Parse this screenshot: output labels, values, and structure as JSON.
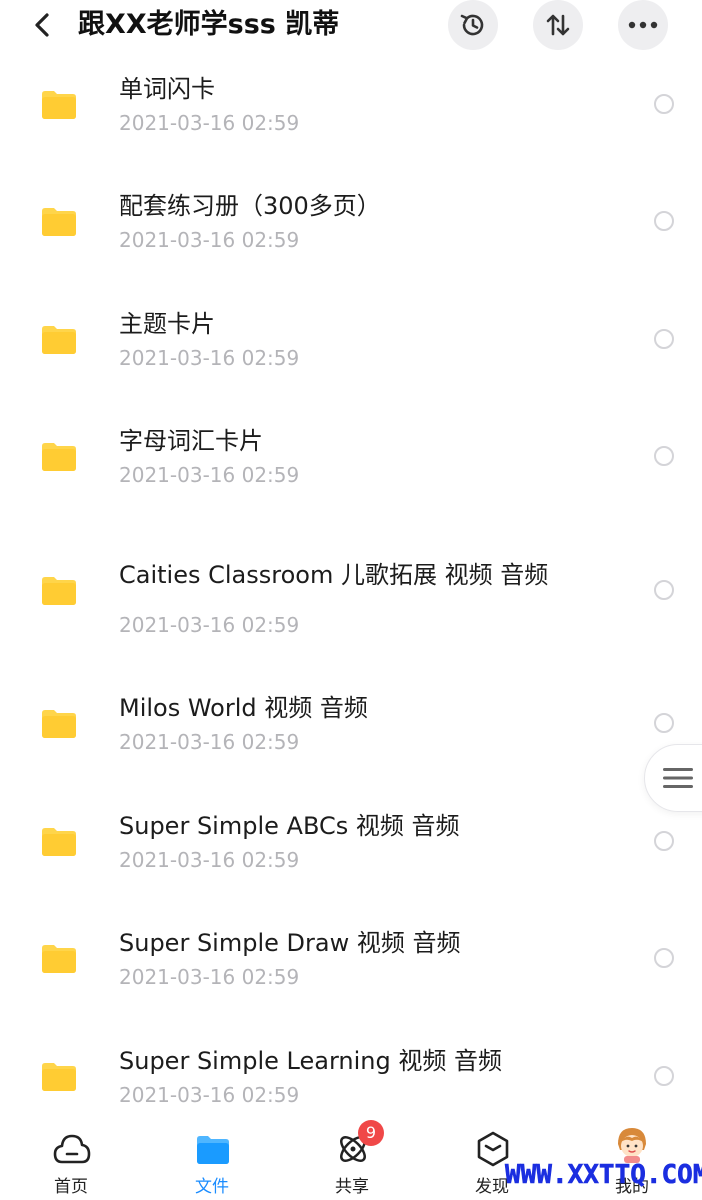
{
  "header": {
    "title": "跟XX老师学sss 凯蒂",
    "back_icon": "chevron-left-icon",
    "history_icon": "history-icon",
    "sort_icon": "sort-icon",
    "more_icon": "more-horizontal-icon"
  },
  "files": [
    {
      "name": "单词闪卡",
      "date": "2021-03-16 02:59"
    },
    {
      "name": "配套练习册（300多页）",
      "date": "2021-03-16 02:59"
    },
    {
      "name": "主题卡片",
      "date": "2021-03-16 02:59"
    },
    {
      "name": "字母词汇卡片",
      "date": "2021-03-16 02:59"
    },
    {
      "name": "Caities Classroom  儿歌拓展  视频  音频",
      "date": "2021-03-16 02:59"
    },
    {
      "name": "Milos World  视频  音频",
      "date": "2021-03-16 02:59"
    },
    {
      "name": "Super Simple ABCs 视频  音频",
      "date": "2021-03-16 02:59"
    },
    {
      "name": "Super Simple Draw 视频  音频",
      "date": "2021-03-16 02:59"
    },
    {
      "name": "Super Simple Learning 视频  音频",
      "date": "2021-03-16 02:59"
    }
  ],
  "tabbar": {
    "tabs": [
      {
        "label": "首页",
        "icon": "cloud-home-icon"
      },
      {
        "label": "文件",
        "icon": "folder-icon"
      },
      {
        "label": "共享",
        "icon": "share-atom-icon",
        "badge": "9"
      },
      {
        "label": "发现",
        "icon": "discover-cube-icon"
      },
      {
        "label": "我的",
        "icon": "avatar-icon"
      }
    ],
    "active_index": 1
  },
  "watermark": "WWW.XXTTQ.COM",
  "colors": {
    "folder": "#FFD54A",
    "accent": "#1A8CFF",
    "badge": "#F04848",
    "date_text": "#B4B4B8",
    "watermark": "#1B2EE0"
  }
}
